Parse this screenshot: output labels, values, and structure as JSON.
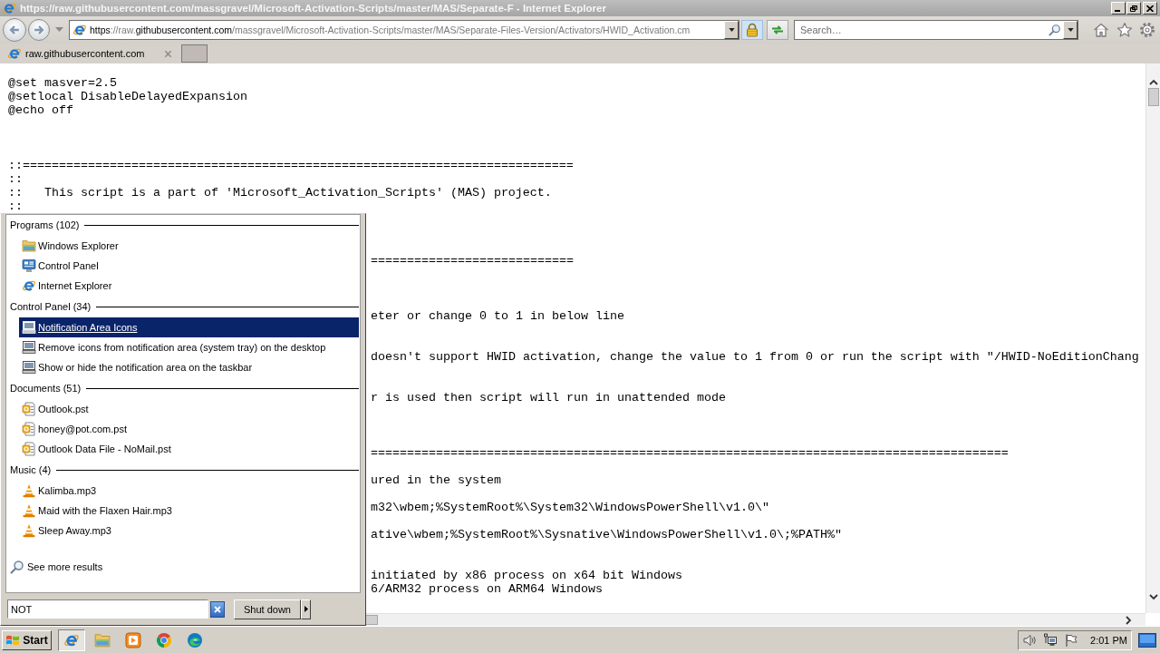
{
  "window": {
    "title": "https://raw.githubusercontent.com/massgravel/Microsoft-Activation-Scripts/master/MAS/Separate-F - Internet Explorer"
  },
  "address_bar": {
    "url": [
      {
        "text": "https",
        "emphasized": true
      },
      {
        "text": "://raw.",
        "emphasized": false
      },
      {
        "text": "githubusercontent.com",
        "emphasized": true
      },
      {
        "text": "/massgravel/Microsoft-Activation-Scripts/master/MAS/Separate-Files-Version/Activators/HWID_Activation.cm",
        "emphasized": false
      }
    ]
  },
  "search": {
    "placeholder": "Search…"
  },
  "tabs": [
    {
      "label": "raw.githubusercontent.com",
      "selected": true
    }
  ],
  "code": {
    "lines": [
      {
        "kind": "text",
        "text": "@set masver=2.5"
      },
      {
        "kind": "text",
        "text": "@setlocal DisableDelayedExpansion"
      },
      {
        "kind": "text",
        "text": "@echo off"
      },
      {
        "kind": "blank"
      },
      {
        "kind": "blank"
      },
      {
        "kind": "blank"
      },
      {
        "kind": "text",
        "text": "::============================================================================"
      },
      {
        "kind": "text",
        "text": "::"
      },
      {
        "kind": "text",
        "text": "::   This script is a part of 'Microsoft_Activation_Scripts' (MAS) project."
      },
      {
        "kind": "text",
        "text": "::"
      },
      {
        "kind": "blank"
      },
      {
        "kind": "blank"
      },
      {
        "kind": "blank"
      },
      {
        "kind": "partly_hidden",
        "text": "============================"
      },
      {
        "kind": "blank"
      },
      {
        "kind": "blank"
      },
      {
        "kind": "blank"
      },
      {
        "kind": "partly_hidden",
        "text": "eter or change 0 to 1 in below line"
      },
      {
        "kind": "blank"
      },
      {
        "kind": "blank"
      },
      {
        "kind": "partly_hidden",
        "text": "doesn't support HWID activation, change the value to 1 from 0 or run the script with \"/HWID-NoEditionChang"
      },
      {
        "kind": "blank"
      },
      {
        "kind": "blank"
      },
      {
        "kind": "partly_hidden",
        "text": "r is used then script will run in unattended mode"
      },
      {
        "kind": "blank"
      },
      {
        "kind": "blank"
      },
      {
        "kind": "blank"
      },
      {
        "kind": "partly_hidden",
        "text": "========================================================================================"
      },
      {
        "kind": "blank"
      },
      {
        "kind": "partly_hidden",
        "text": "ured in the system"
      },
      {
        "kind": "blank"
      },
      {
        "kind": "partly_hidden",
        "text": "m32\\wbem;%SystemRoot%\\System32\\WindowsPowerShell\\v1.0\\\""
      },
      {
        "kind": "blank"
      },
      {
        "kind": "partly_hidden",
        "text": "ative\\wbem;%SystemRoot%\\Sysnative\\WindowsPowerShell\\v1.0\\;%PATH%\""
      },
      {
        "kind": "blank"
      },
      {
        "kind": "blank"
      },
      {
        "kind": "partly_hidden",
        "text": "initiated by x86 process on x64 bit Windows"
      },
      {
        "kind": "partly_hidden",
        "text": "6/ARM32 process on ARM64 Windows"
      }
    ]
  },
  "start_menu": {
    "groups": [
      {
        "heading": "Programs (102)",
        "items": [
          {
            "label": "Windows Explorer",
            "kind": "file_manager",
            "selected": false
          },
          {
            "label": "Control Panel",
            "kind": "control_panel",
            "selected": false
          },
          {
            "label": "Internet Explorer",
            "kind": "browser",
            "selected": false
          }
        ]
      },
      {
        "heading": "Control Panel (34)",
        "items": [
          {
            "label": "Notification Area Icons",
            "kind": "setting",
            "selected": true
          },
          {
            "label": "Remove icons from notification area (system tray) on the desktop",
            "kind": "setting",
            "selected": false
          },
          {
            "label": "Show or hide the notification area on the taskbar",
            "kind": "setting",
            "selected": false
          }
        ]
      },
      {
        "heading": "Documents (51)",
        "items": [
          {
            "label": "Outlook.pst",
            "kind": "document",
            "selected": false
          },
          {
            "label": "honey@pot.com.pst",
            "kind": "document",
            "selected": false
          },
          {
            "label": "Outlook Data File - NoMail.pst",
            "kind": "document",
            "selected": false
          }
        ]
      },
      {
        "heading": "Music (4)",
        "items": [
          {
            "label": "Kalimba.mp3",
            "kind": "audio",
            "selected": false
          },
          {
            "label": "Maid with the Flaxen Hair.mp3",
            "kind": "audio",
            "selected": false
          },
          {
            "label": "Sleep Away.mp3",
            "kind": "audio",
            "selected": false
          }
        ]
      }
    ],
    "more_results": "See more results",
    "search": {
      "value": "NOT"
    },
    "shutdown_label": "Shut down"
  },
  "taskbar": {
    "start_label": "Start",
    "apps": [
      {
        "kind": "ie",
        "selected": true
      },
      {
        "kind": "explorer",
        "selected": false
      },
      {
        "kind": "media",
        "selected": false
      },
      {
        "kind": "chrome",
        "selected": false
      },
      {
        "kind": "edge",
        "selected": false
      }
    ],
    "clock": "2:01 PM"
  }
}
